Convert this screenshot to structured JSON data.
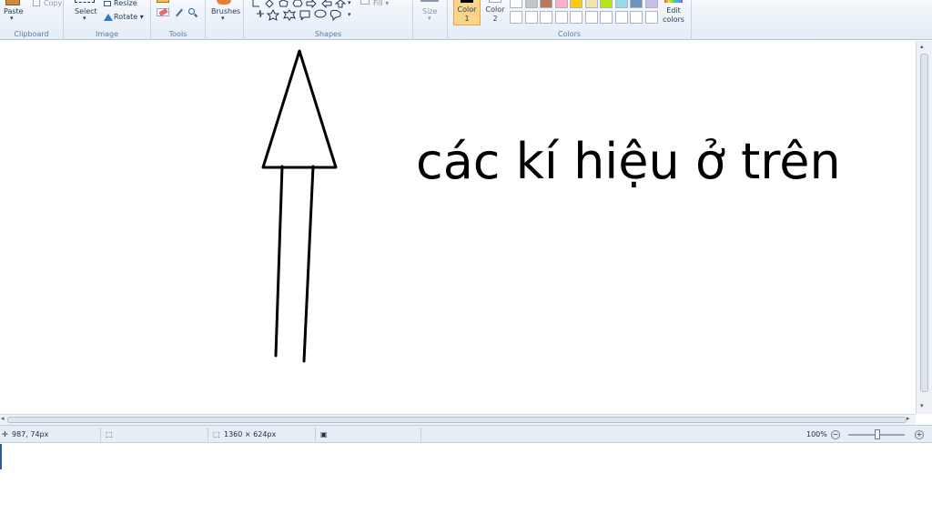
{
  "ribbon": {
    "clipboard": {
      "paste": "Paste",
      "copy": "Copy",
      "group": "Clipboard"
    },
    "image": {
      "select": "Select",
      "resize": "Resize",
      "rotate": "Rotate ▾",
      "group": "Image"
    },
    "tools": {
      "group": "Tools"
    },
    "brushes": {
      "label": "Brushes",
      "group": ""
    },
    "shapes": {
      "fill": "Fill ▾",
      "group": "Shapes"
    },
    "size": {
      "label": "Size"
    },
    "colors": {
      "color1": "Color\n1",
      "color2": "Color\n2",
      "edit": "Edit\ncolors",
      "group": "Colors",
      "active_color": "#000000",
      "swatches_top": [
        "#ffffff",
        "#c3c3c3",
        "#b97a57",
        "#ffaec9",
        "#ffc90e",
        "#efe4b0",
        "#b5e61d",
        "#99d9ea",
        "#7092be",
        "#c8bfe7"
      ],
      "swatches_bottom": [
        "#ffffff",
        "#ffffff",
        "#ffffff",
        "#ffffff",
        "#ffffff",
        "#ffffff",
        "#ffffff",
        "#ffffff",
        "#ffffff",
        "#ffffff"
      ]
    }
  },
  "canvas": {
    "text": "các kí hiệu ở trên"
  },
  "status": {
    "cursor_pos": "987, 74px",
    "image_size": "1360 × 624px",
    "zoom": "100%"
  }
}
